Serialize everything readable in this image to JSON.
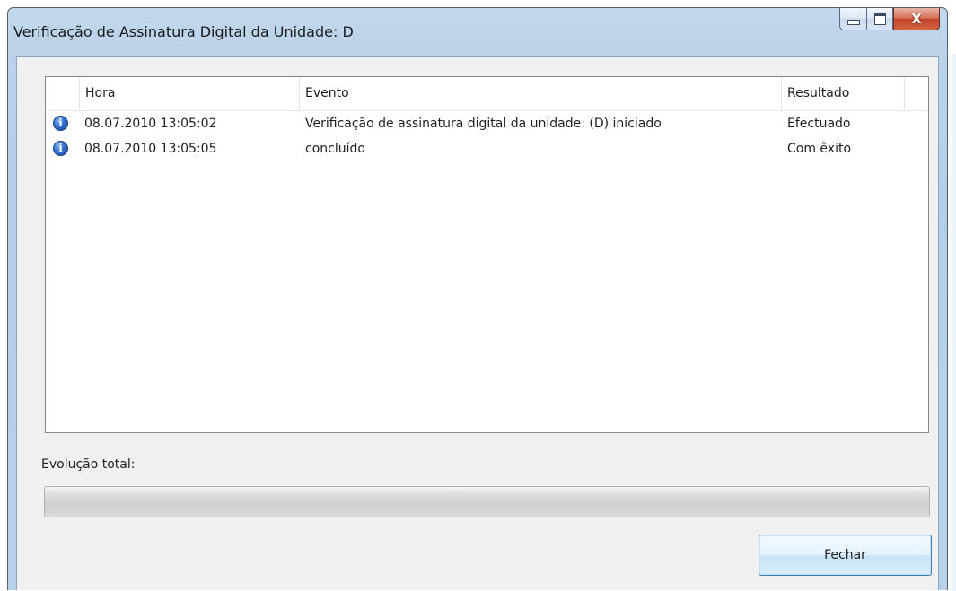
{
  "window": {
    "title": "Verificação de Assinatura Digital da Unidade: D",
    "controls": {
      "minimize": "minimize-icon",
      "maximize": "maximize-icon",
      "close_glyph": "X"
    }
  },
  "table": {
    "columns": [
      "Hora",
      "Evento",
      "Resultado"
    ],
    "rows": [
      {
        "icon": "info-icon",
        "time": "08.07.2010 13:05:02",
        "event": "Verificação de assinatura digital da unidade: (D) iniciado",
        "result": "Efectuado"
      },
      {
        "icon": "info-icon",
        "time": "08.07.2010 13:05:05",
        "event": "concluído",
        "result": "Com êxito"
      }
    ]
  },
  "progress": {
    "label": "Evolução total:",
    "value_percent": 0
  },
  "buttons": {
    "close_label": "Fechar"
  },
  "colors": {
    "title_bar": "#bcd3ea",
    "close_button": "#c4432a",
    "dialog_body": "#f0f0f0",
    "info_icon": "#2f6fd0"
  }
}
